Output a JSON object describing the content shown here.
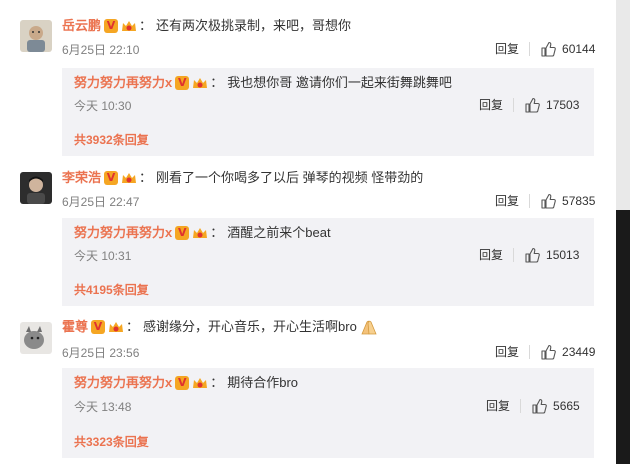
{
  "comments": [
    {
      "user": "岳云鹏",
      "text": "还有两次极挑录制，来吧，哥想你",
      "time": "6月25日 22:10",
      "reply_label": "回复",
      "likes": "60144",
      "reply": {
        "user": "努力努力再努力x",
        "text": "我也想你哥 邀请你们一起来街舞跳舞吧",
        "time": "今天 10:30",
        "reply_label": "回复",
        "likes": "17503"
      },
      "total": "共3932条回复"
    },
    {
      "user": "李荣浩",
      "text": "刚看了一个你喝多了以后 弹琴的视频 怪带劲的",
      "time": "6月25日 22:47",
      "reply_label": "回复",
      "likes": "57835",
      "reply": {
        "user": "努力努力再努力x",
        "text": "酒醒之前来个beat",
        "time": "今天 10:31",
        "reply_label": "回复",
        "likes": "15013"
      },
      "total": "共4195条回复"
    },
    {
      "user": "霍尊",
      "text": "感谢缘分，开心音乐，开心生活啊bro",
      "time": "6月25日 23:56",
      "reply_label": "回复",
      "likes": "23449",
      "reply": {
        "user": "努力努力再努力x",
        "text": "期待合作bro",
        "time": "今天 13:48",
        "reply_label": "回复",
        "likes": "5665"
      },
      "total": "共3323条回复"
    }
  ],
  "colors": {
    "username": "#eb7350",
    "reply_bg": "#f2f2f5",
    "meta": "#808080"
  },
  "icons": {
    "verified": "verified-v-icon",
    "member": "member-crown-icon",
    "like": "thumbs-up-icon",
    "emoji": "folded-hands-icon"
  }
}
